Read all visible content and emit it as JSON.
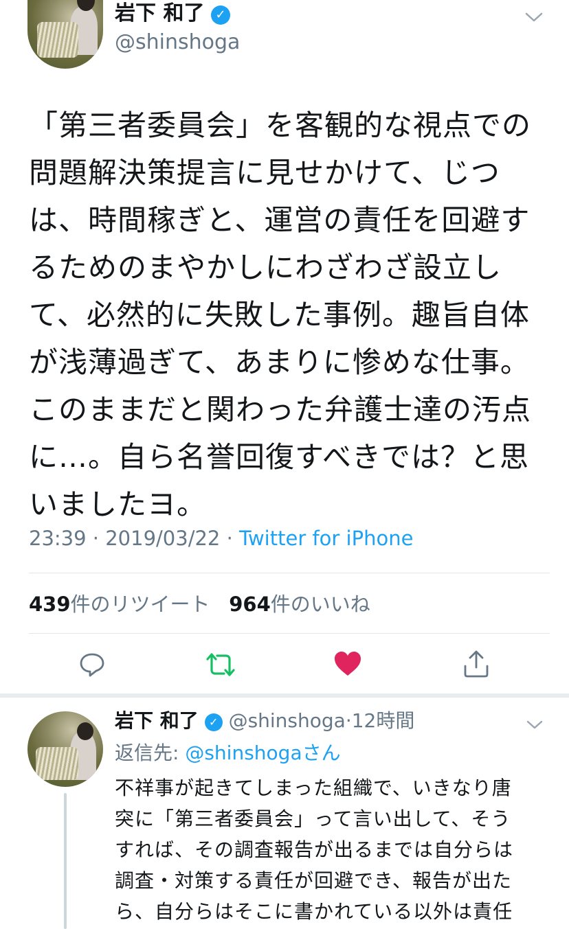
{
  "tweet": {
    "author_name": "岩下 和了",
    "handle": "@shinshoga",
    "text": "「第三者委員会」を客観的な視点での問題解決策提言に見せかけて、じつは、時間稼ぎと、運営の責任を回避するためのまやかしにわざわざ設立して、必然的に失敗した事例。趣旨自体が浅薄過ぎて、あまりに惨めな仕事。このままだと関わった弁護士達の汚点に…。自ら名誉回復すべきでは？と思いましたヨ。",
    "time": "23:39",
    "sep": "·",
    "date": "2019/03/22",
    "source": "Twitter for iPhone"
  },
  "stats": {
    "retweets_count": "439",
    "retweets_label": "件のリツイート",
    "likes_count": "964",
    "likes_label": "件のいいね"
  },
  "actions": {
    "reply_icon": "reply-icon",
    "retweet_icon": "retweet-icon",
    "like_icon": "heart-icon",
    "share_icon": "share-icon"
  },
  "reply": {
    "author_name": "岩下 和了",
    "handle": "@shinshoga",
    "sep": "·",
    "time_ago": "12時間",
    "replying_label": "返信先: ",
    "replying_to": "@shinshogaさん",
    "text": "不祥事が起きてしまった組織で、いきなり唐突に「第三者委員会」って言い出して、そうすれば、その調査報告が出るまでは自分らは調査・対策する責任が回避でき、報告が出たら、自分らはそこに書かれている以外は責任"
  },
  "colors": {
    "accent": "#1da1f2",
    "retweeted": "#17bf63",
    "liked": "#e0245e",
    "secondary_text": "#657786"
  }
}
